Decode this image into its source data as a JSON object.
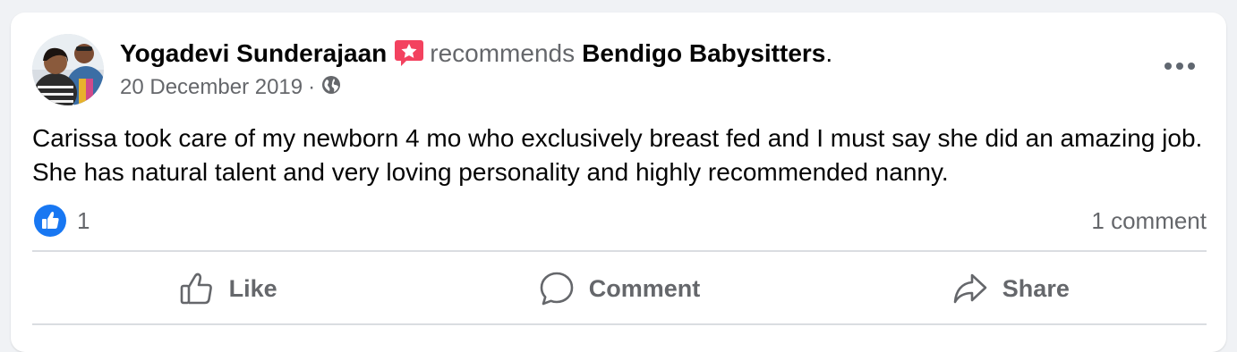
{
  "post": {
    "author": "Yogadevi Sunderajaan",
    "verb": "recommends",
    "page": "Bendigo Babysitters",
    "period": ".",
    "date": "20 December 2019",
    "separator": "·",
    "audience_icon": "globe-icon",
    "badge_icon": "star-recommendation-icon",
    "menu_icon": "more-options-icon",
    "body": "Carissa took care of my newborn 4 mo who exclusively breast fed and I must say she did an amazing job. She has natural talent and very loving personality and highly recommended nanny."
  },
  "engagement": {
    "reaction_icon": "like-reaction-icon",
    "reaction_count": "1",
    "comments": "1 comment"
  },
  "actions": {
    "like": "Like",
    "comment": "Comment",
    "share": "Share"
  },
  "colors": {
    "background": "#f0f2f5",
    "card": "#ffffff",
    "text": "#050505",
    "muted": "#65676b",
    "like_blue": "#1877f2",
    "badge_red": "#f02849"
  }
}
